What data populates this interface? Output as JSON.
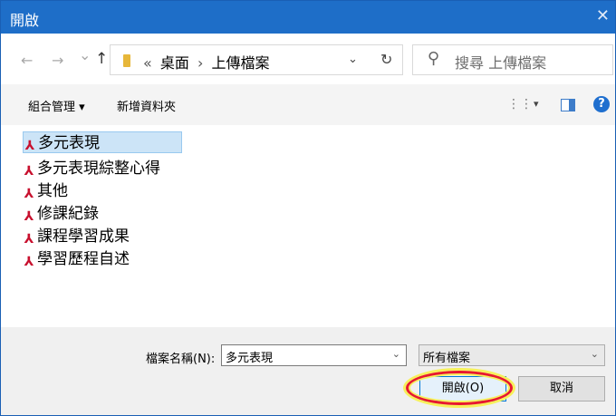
{
  "window": {
    "title": "開啟",
    "close_glyph": "✕"
  },
  "nav": {
    "back": "←",
    "forward": "→",
    "recent": "⌄",
    "up": "↑"
  },
  "address": {
    "crumbs_prefix": "«",
    "crumb_1": "桌面",
    "separator": "›",
    "crumb_2": "上傳檔案",
    "dropdown": "⌄",
    "refresh": "↻"
  },
  "search": {
    "placeholder": "搜尋 上傳檔案",
    "icon": "⚲"
  },
  "toolbar": {
    "organize": "組合管理 ▾",
    "new_folder": "新增資料夾",
    "view_icon": "⋮⋮",
    "view_drop": "▾",
    "help": "?"
  },
  "files": [
    {
      "name": "多元表現",
      "selected": true
    },
    {
      "name": "多元表現綜整心得",
      "selected": false
    },
    {
      "name": "其他",
      "selected": false
    },
    {
      "name": "修課紀錄",
      "selected": false
    },
    {
      "name": "課程學習成果",
      "selected": false
    },
    {
      "name": "學習歷程自述",
      "selected": false
    }
  ],
  "icons": {
    "pdf": "⅄"
  },
  "footer": {
    "filename_label": "檔案名稱(N):",
    "filename_value": "多元表現",
    "filename_drop": "⌄",
    "filetype_value": "所有檔案",
    "filetype_drop": "⌄",
    "open_label": "開啟(O)",
    "cancel_label": "取消"
  },
  "colors": {
    "titlebar": "#1e6ec8",
    "selection": "#cce4f7",
    "highlight_ring": "#e8182e",
    "highlight_glow": "#f7f05a"
  }
}
